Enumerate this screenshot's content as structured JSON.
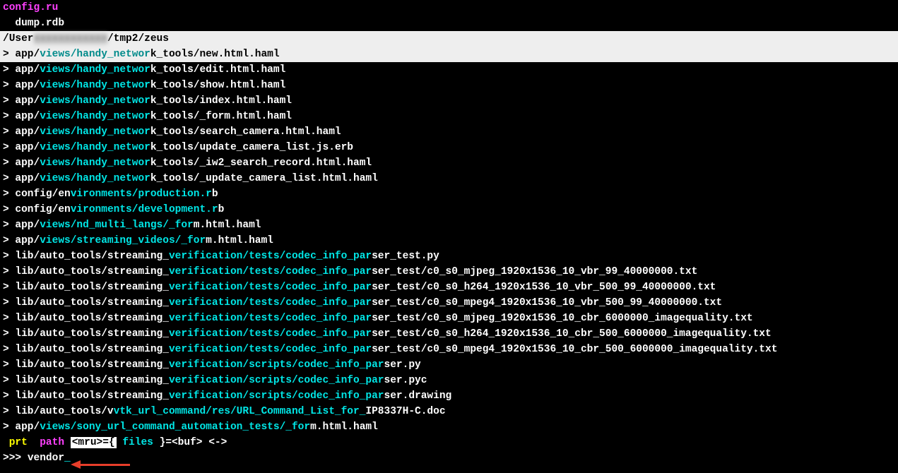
{
  "top": {
    "line1_text": "config.ru",
    "line2_indent": "  ",
    "line2_text": "dump.rdb"
  },
  "pathbar": {
    "prefix": "/User",
    "blurred": "xxxxxxxxxxxx",
    "suffix": "/tmp2/zeus"
  },
  "rows": [
    {
      "selected": true,
      "segs": [
        [
          "white",
          "app/"
        ],
        [
          "cyan",
          "views/handy_networ"
        ],
        [
          "white",
          "k_tools/new.html.haml"
        ]
      ]
    },
    {
      "selected": false,
      "segs": [
        [
          "white",
          "app/"
        ],
        [
          "cyan",
          "views/handy_networ"
        ],
        [
          "white",
          "k_tools/edit.html.haml"
        ]
      ]
    },
    {
      "selected": false,
      "segs": [
        [
          "white",
          "app/"
        ],
        [
          "cyan",
          "views/handy_networ"
        ],
        [
          "white",
          "k_tools/show.html.haml"
        ]
      ]
    },
    {
      "selected": false,
      "segs": [
        [
          "white",
          "app/"
        ],
        [
          "cyan",
          "views/handy_networ"
        ],
        [
          "white",
          "k_tools/index.html.haml"
        ]
      ]
    },
    {
      "selected": false,
      "segs": [
        [
          "white",
          "app/"
        ],
        [
          "cyan",
          "views/handy_networ"
        ],
        [
          "white",
          "k_tools/_form.html.haml"
        ]
      ]
    },
    {
      "selected": false,
      "segs": [
        [
          "white",
          "app/"
        ],
        [
          "cyan",
          "views/handy_networ"
        ],
        [
          "white",
          "k_tools/search_camera.html.haml"
        ]
      ]
    },
    {
      "selected": false,
      "segs": [
        [
          "white",
          "app/"
        ],
        [
          "cyan",
          "views/handy_networ"
        ],
        [
          "white",
          "k_tools/update_camera_list.js.erb"
        ]
      ]
    },
    {
      "selected": false,
      "segs": [
        [
          "white",
          "app/"
        ],
        [
          "cyan",
          "views/handy_networ"
        ],
        [
          "white",
          "k_tools/_iw2_search_record.html.haml"
        ]
      ]
    },
    {
      "selected": false,
      "segs": [
        [
          "white",
          "app/"
        ],
        [
          "cyan",
          "views/handy_networ"
        ],
        [
          "white",
          "k_tools/_update_camera_list.html.haml"
        ]
      ]
    },
    {
      "selected": false,
      "segs": [
        [
          "white",
          "config/en"
        ],
        [
          "cyan",
          "vironments/production.r"
        ],
        [
          "white",
          "b"
        ]
      ]
    },
    {
      "selected": false,
      "segs": [
        [
          "white",
          "config/en"
        ],
        [
          "cyan",
          "vironments/development.r"
        ],
        [
          "white",
          "b"
        ]
      ]
    },
    {
      "selected": false,
      "segs": [
        [
          "white",
          "app/"
        ],
        [
          "cyan",
          "views/nd_multi_langs/_for"
        ],
        [
          "white",
          "m.html.haml"
        ]
      ]
    },
    {
      "selected": false,
      "segs": [
        [
          "white",
          "app/"
        ],
        [
          "cyan",
          "views/streaming_videos/_for"
        ],
        [
          "white",
          "m.html.haml"
        ]
      ]
    },
    {
      "selected": false,
      "segs": [
        [
          "white",
          "lib/auto_tools/streaming_"
        ],
        [
          "cyan",
          "verification/tests/codec_info_par"
        ],
        [
          "white",
          "ser_test.py"
        ]
      ]
    },
    {
      "selected": false,
      "segs": [
        [
          "white",
          "lib/auto_tools/streaming_"
        ],
        [
          "cyan",
          "verification/tests/codec_info_par"
        ],
        [
          "white",
          "ser_test/c0_s0_mjpeg_1920x1536_10_vbr_99_40000000.txt"
        ]
      ]
    },
    {
      "selected": false,
      "segs": [
        [
          "white",
          "lib/auto_tools/streaming_"
        ],
        [
          "cyan",
          "verification/tests/codec_info_par"
        ],
        [
          "white",
          "ser_test/c0_s0_h264_1920x1536_10_vbr_500_99_40000000.txt"
        ]
      ]
    },
    {
      "selected": false,
      "segs": [
        [
          "white",
          "lib/auto_tools/streaming_"
        ],
        [
          "cyan",
          "verification/tests/codec_info_par"
        ],
        [
          "white",
          "ser_test/c0_s0_mpeg4_1920x1536_10_vbr_500_99_40000000.txt"
        ]
      ]
    },
    {
      "selected": false,
      "segs": [
        [
          "white",
          "lib/auto_tools/streaming_"
        ],
        [
          "cyan",
          "verification/tests/codec_info_par"
        ],
        [
          "white",
          "ser_test/c0_s0_mjpeg_1920x1536_10_cbr_6000000_imagequality.txt"
        ]
      ]
    },
    {
      "selected": false,
      "segs": [
        [
          "white",
          "lib/auto_tools/streaming_"
        ],
        [
          "cyan",
          "verification/tests/codec_info_par"
        ],
        [
          "white",
          "ser_test/c0_s0_h264_1920x1536_10_cbr_500_6000000_imagequality.txt"
        ]
      ]
    },
    {
      "selected": false,
      "segs": [
        [
          "white",
          "lib/auto_tools/streaming_"
        ],
        [
          "cyan",
          "verification/tests/codec_info_par"
        ],
        [
          "white",
          "ser_test/c0_s0_mpeg4_1920x1536_10_cbr_500_6000000_imagequality.txt"
        ]
      ]
    },
    {
      "selected": false,
      "segs": [
        [
          "white",
          "lib/auto_tools/streaming_"
        ],
        [
          "cyan",
          "verification/scripts/codec_info_par"
        ],
        [
          "white",
          "ser.py"
        ]
      ]
    },
    {
      "selected": false,
      "segs": [
        [
          "white",
          "lib/auto_tools/streaming_"
        ],
        [
          "cyan",
          "verification/scripts/codec_info_par"
        ],
        [
          "white",
          "ser.pyc"
        ]
      ]
    },
    {
      "selected": false,
      "segs": [
        [
          "white",
          "lib/auto_tools/streaming_"
        ],
        [
          "cyan",
          "verification/scripts/codec_info_par"
        ],
        [
          "white",
          "ser.drawing"
        ]
      ]
    },
    {
      "selected": false,
      "segs": [
        [
          "white",
          "lib/auto_tools/v"
        ],
        [
          "cyan",
          "vtk_url_command/res/URL_Command_List_for_"
        ],
        [
          "white",
          "IP8337H-C.doc"
        ]
      ]
    },
    {
      "selected": false,
      "segs": [
        [
          "white",
          "app/"
        ],
        [
          "cyan",
          "views/sony_url_command_automation_tests/_for"
        ],
        [
          "white",
          "m.html.haml"
        ]
      ]
    }
  ],
  "status": {
    "prt": "prt",
    "path": "path",
    "mru": "<mru>={",
    "files": "files",
    "buf": "}=<buf>",
    "arrows": "<->"
  },
  "prompt": {
    "chevrons": ">>> ",
    "input": "vendor",
    "cursor": "_"
  }
}
